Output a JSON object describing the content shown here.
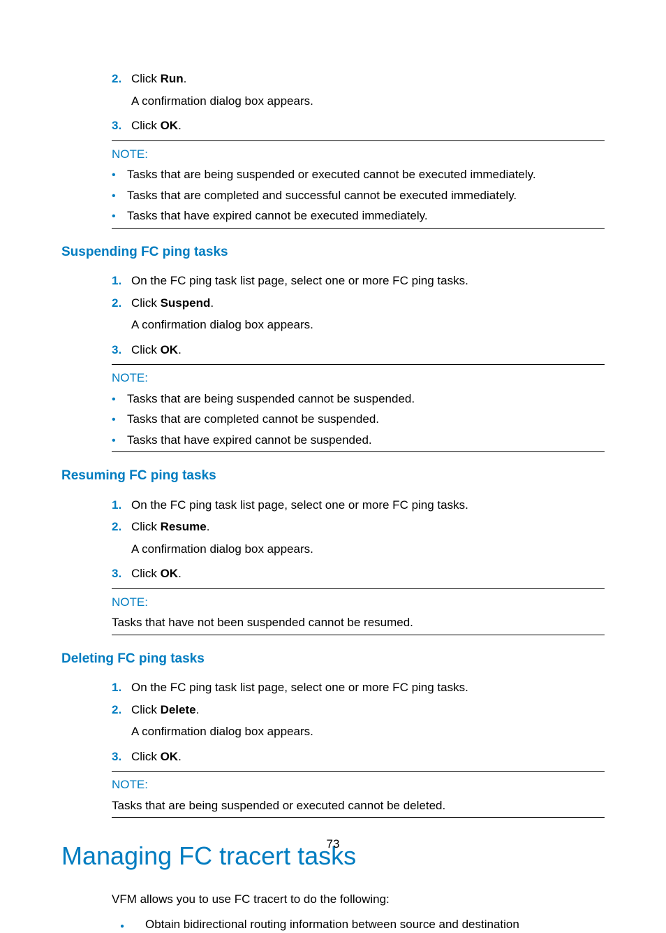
{
  "top": {
    "steps": [
      {
        "num": "2.",
        "prefix": "Click ",
        "bold": "Run",
        "suffix": ".",
        "sub": "A confirmation dialog box appears."
      },
      {
        "num": "3.",
        "prefix": "Click ",
        "bold": "OK",
        "suffix": "."
      }
    ],
    "noteLabel": "NOTE:",
    "notes": [
      "Tasks that are being suspended or executed cannot be executed immediately.",
      "Tasks that are completed and successful cannot be executed immediately.",
      "Tasks that have expired cannot be executed immediately."
    ]
  },
  "suspending": {
    "title": "Suspending FC ping tasks",
    "steps": [
      {
        "num": "1.",
        "text": "On the FC ping task list page, select one or more FC ping tasks."
      },
      {
        "num": "2.",
        "prefix": "Click ",
        "bold": "Suspend",
        "suffix": ".",
        "sub": "A confirmation dialog box appears."
      },
      {
        "num": "3.",
        "prefix": "Click ",
        "bold": "OK",
        "suffix": "."
      }
    ],
    "noteLabel": "NOTE:",
    "notes": [
      "Tasks that are being suspended cannot be suspended.",
      "Tasks that are completed cannot be suspended.",
      "Tasks that have expired cannot be suspended."
    ]
  },
  "resuming": {
    "title": "Resuming FC ping tasks",
    "steps": [
      {
        "num": "1.",
        "text": "On the FC ping task list page, select one or more FC ping tasks."
      },
      {
        "num": "2.",
        "prefix": "Click ",
        "bold": "Resume",
        "suffix": ".",
        "sub": "A confirmation dialog box appears."
      },
      {
        "num": "3.",
        "prefix": "Click ",
        "bold": "OK",
        "suffix": "."
      }
    ],
    "noteLabel": "NOTE:",
    "noteText": "Tasks that have not been suspended cannot be resumed."
  },
  "deleting": {
    "title": "Deleting FC ping tasks",
    "steps": [
      {
        "num": "1.",
        "text": "On the FC ping task list page, select one or more FC ping tasks."
      },
      {
        "num": "2.",
        "prefix": "Click ",
        "bold": "Delete",
        "suffix": ".",
        "sub": "A confirmation dialog box appears."
      },
      {
        "num": "3.",
        "prefix": "Click ",
        "bold": "OK",
        "suffix": "."
      }
    ],
    "noteLabel": "NOTE:",
    "noteText": "Tasks that are being suspended or executed cannot be deleted."
  },
  "tracert": {
    "title": "Managing FC tracert tasks",
    "intro": "VFM allows you to use FC tracert to do the following:",
    "items": [
      "Obtain bidirectional routing information between source and destination"
    ]
  },
  "pageNumber": "73"
}
